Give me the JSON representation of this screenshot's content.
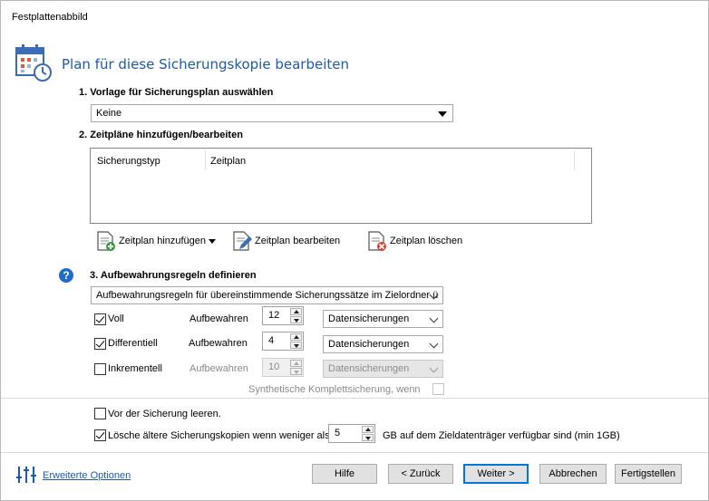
{
  "window": {
    "title": "Festplattenabbild"
  },
  "header": {
    "title": "Plan für diese Sicherungskopie bearbeiten",
    "icon": "calendar-icon"
  },
  "section1": {
    "label": "1. Vorlage für Sicherungsplan auswählen",
    "template_select": "Keine"
  },
  "section2": {
    "label": "2. Zeitpläne hinzufügen/bearbeiten",
    "columns": [
      "Sicherungstyp",
      "Zeitplan"
    ],
    "add_label": "Zeitplan hinzufügen",
    "edit_label": "Zeitplan bearbeiten",
    "delete_label": "Zeitplan löschen"
  },
  "section3": {
    "label": "3. Aufbewahrungsregeln definieren",
    "scope_select": "Aufbewahrungsregeln für übereinstimmende Sicherungssätze im Zielordner ü",
    "rows": [
      {
        "name": "Voll",
        "checked": true,
        "keep_label": "Aufbewahren",
        "count": "12",
        "unit": "Datensicherungen",
        "enabled": true
      },
      {
        "name": "Differentiell",
        "checked": true,
        "keep_label": "Aufbewahren",
        "count": "4",
        "unit": "Datensicherungen",
        "enabled": true
      },
      {
        "name": "Inkrementell",
        "checked": false,
        "keep_label": "Aufbewahren",
        "count": "10",
        "unit": "Datensicherungen",
        "enabled": false
      }
    ],
    "synthetic_label": "Synthetische Komplettsicherung, wenn"
  },
  "options": {
    "empty_before_label": "Vor der Sicherung leeren.",
    "delete_older_label": "Lösche ältere Sicherungskopien wenn weniger als",
    "delete_older_value": "5",
    "delete_older_suffix": "GB auf dem Zieldatenträger verfügbar sind (min 1GB)"
  },
  "footer": {
    "advanced_link": "Erweiterte Optionen",
    "help": "Hilfe",
    "back": "< Zurück",
    "next": "Weiter >",
    "cancel": "Abbrechen",
    "finish": "Fertigstellen"
  },
  "colors": {
    "accent": "#1e5aa8",
    "primary_border": "#0078d7",
    "help_icon": "#1e6cc8"
  }
}
